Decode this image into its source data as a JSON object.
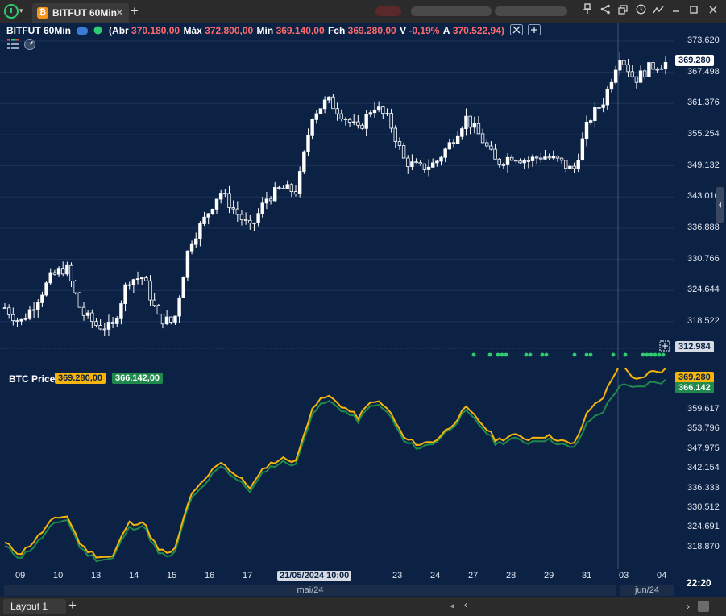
{
  "tabs": [
    {
      "label": "BITFUT 60Min",
      "icon": "bitcoin-icon",
      "close": "✕"
    }
  ],
  "add_tab_label": "+",
  "titlebar_icons": [
    "pin-icon",
    "share-icon",
    "copy-window-icon",
    "clock-icon",
    "activity-icon",
    "minimize-icon",
    "maximize-icon",
    "close-icon"
  ],
  "header": {
    "symbol": "BITFUT 60Min",
    "open_label": "(Abr",
    "open": "370.180,00",
    "high_label": "Máx",
    "high": "372.800,00",
    "low_label": "Mín",
    "low": "369.140,00",
    "close_label": "Fch",
    "close": "369.280,00",
    "var_label": "V",
    "var": "-0,19%",
    "avg_label": "A",
    "avg": "370.522,94)"
  },
  "price_axis": {
    "labels": [
      "373.620",
      "367.498",
      "361.376",
      "355.254",
      "349.132",
      "343.010",
      "336.888",
      "330.766",
      "324.644",
      "318.522"
    ],
    "last_price": "369.280",
    "crosshair_price": "312.984"
  },
  "indicator": {
    "name": "BTC Price",
    "value1": "369.280,00",
    "value2": "366.142,00",
    "axis_labels": [
      "359.617",
      "353.796",
      "347.975",
      "342.154",
      "336.333",
      "330.512",
      "324.691",
      "318.870"
    ],
    "last1": "369.280",
    "last2": "366.142"
  },
  "time_axis": {
    "labels": [
      "09",
      "10",
      "13",
      "14",
      "15",
      "16",
      "17",
      "21/05/2024 10:00",
      "23",
      "24",
      "27",
      "28",
      "29",
      "31",
      "03",
      "04"
    ],
    "months": [
      "mai/24",
      "jun/24"
    ],
    "clock": "22:20"
  },
  "layout_tab": "Layout 1",
  "colors": {
    "background": "#0c2245",
    "candle": "#ffffff",
    "line1": "#f5b50a",
    "line2": "#1f8a4c",
    "negative": "#ff6b6b",
    "signal": "#2ecc71"
  },
  "chart_data": {
    "type": "line",
    "title": "BITFUT 60Min",
    "ylim_price": [
      312.984,
      373.62
    ],
    "ylim_indicator": [
      316,
      368
    ],
    "series": [
      {
        "name": "BTC Price",
        "values": [
          321.0,
          318.0,
          322.0,
          327.0,
          329.0,
          320.0,
          317.5,
          317.0,
          326.5,
          327.0,
          319.0,
          318.0,
          333.5,
          338.5,
          344.0,
          340.0,
          336.5,
          342.5,
          344.5,
          344.0,
          359.0,
          362.0,
          359.0,
          356.0,
          361.0,
          358.0,
          350.0,
          348.5,
          349.5,
          353.5,
          358.5,
          354.5,
          349.5,
          351.0,
          350.0,
          351.0,
          350.0,
          348.0,
          358.0,
          362.0,
          371.0,
          366.0,
          368.5,
          369.28
        ]
      },
      {
        "name": "",
        "values": [
          320.0,
          317.0,
          320.5,
          325.5,
          328.0,
          319.0,
          316.5,
          316.5,
          325.0,
          326.0,
          318.0,
          317.0,
          332.5,
          337.0,
          343.0,
          339.0,
          335.5,
          341.5,
          343.5,
          343.0,
          357.5,
          360.5,
          358.0,
          355.0,
          360.0,
          357.0,
          349.0,
          347.5,
          349.0,
          353.0,
          357.5,
          353.5,
          348.5,
          350.0,
          349.0,
          350.0,
          349.0,
          347.0,
          355.0,
          358.0,
          365.0,
          364.0,
          365.5,
          366.142
        ]
      }
    ]
  }
}
